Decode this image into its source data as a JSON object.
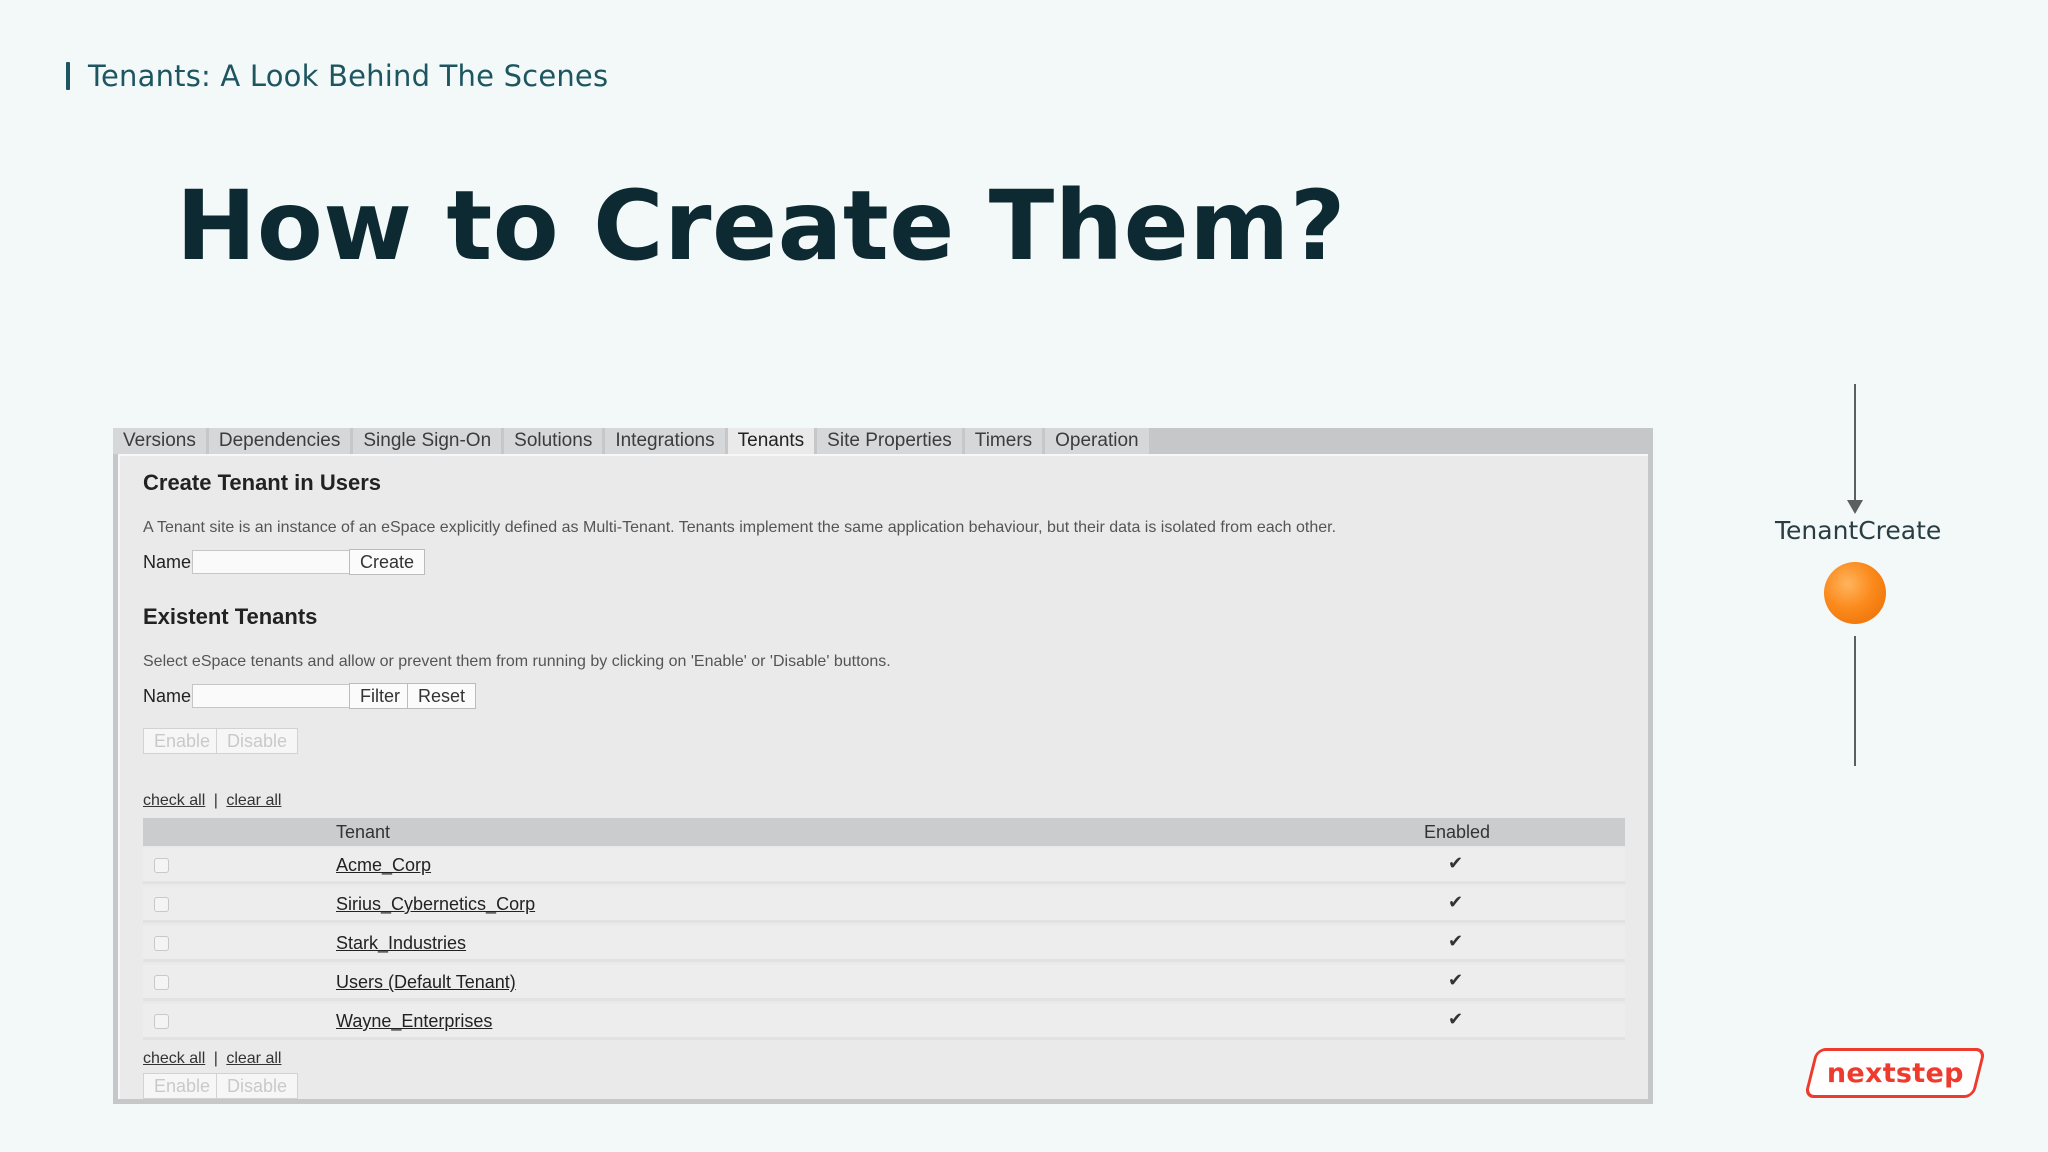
{
  "slide": {
    "section_label": "Tenants: A Look Behind The Scenes",
    "title": "How to Create Them?"
  },
  "tabs": [
    {
      "label": "Versions",
      "active": false
    },
    {
      "label": "Dependencies",
      "active": false
    },
    {
      "label": "Single Sign-On",
      "active": false
    },
    {
      "label": "Solutions",
      "active": false
    },
    {
      "label": "Integrations",
      "active": false
    },
    {
      "label": "Tenants",
      "active": true
    },
    {
      "label": "Site Properties",
      "active": false
    },
    {
      "label": "Timers",
      "active": false
    },
    {
      "label": "Operation",
      "active": false
    }
  ],
  "create_section": {
    "heading": "Create Tenant in Users",
    "description": "A Tenant site is an instance of an eSpace explicitly defined as Multi-Tenant. Tenants implement the same application behaviour, but their data is isolated from each other.",
    "name_label": "Name:",
    "name_value": "",
    "create_button": "Create"
  },
  "existent_section": {
    "heading": "Existent Tenants",
    "description": "Select eSpace tenants and allow or prevent them from running by clicking on 'Enable' or 'Disable' buttons.",
    "name_label": "Name:",
    "name_value": "",
    "filter_button": "Filter",
    "reset_button": "Reset",
    "enable_button": "Enable",
    "disable_button": "Disable",
    "check_all": "check all",
    "separator": "|",
    "clear_all": "clear all"
  },
  "table": {
    "columns": [
      "Tenant",
      "Enabled"
    ],
    "rows": [
      {
        "tenant": "Acme_Corp",
        "enabled": "✔"
      },
      {
        "tenant": "Sirius_Cybernetics_Corp",
        "enabled": "✔"
      },
      {
        "tenant": "Stark_Industries",
        "enabled": "✔"
      },
      {
        "tenant": "Users (Default Tenant)",
        "enabled": "✔"
      },
      {
        "tenant": "Wayne_Enterprises",
        "enabled": "✔"
      }
    ]
  },
  "flow": {
    "label": "TenantCreate",
    "node_color": "#fb8a1c"
  },
  "logo": {
    "text": "nextstep",
    "color": "#ee3b2d"
  }
}
